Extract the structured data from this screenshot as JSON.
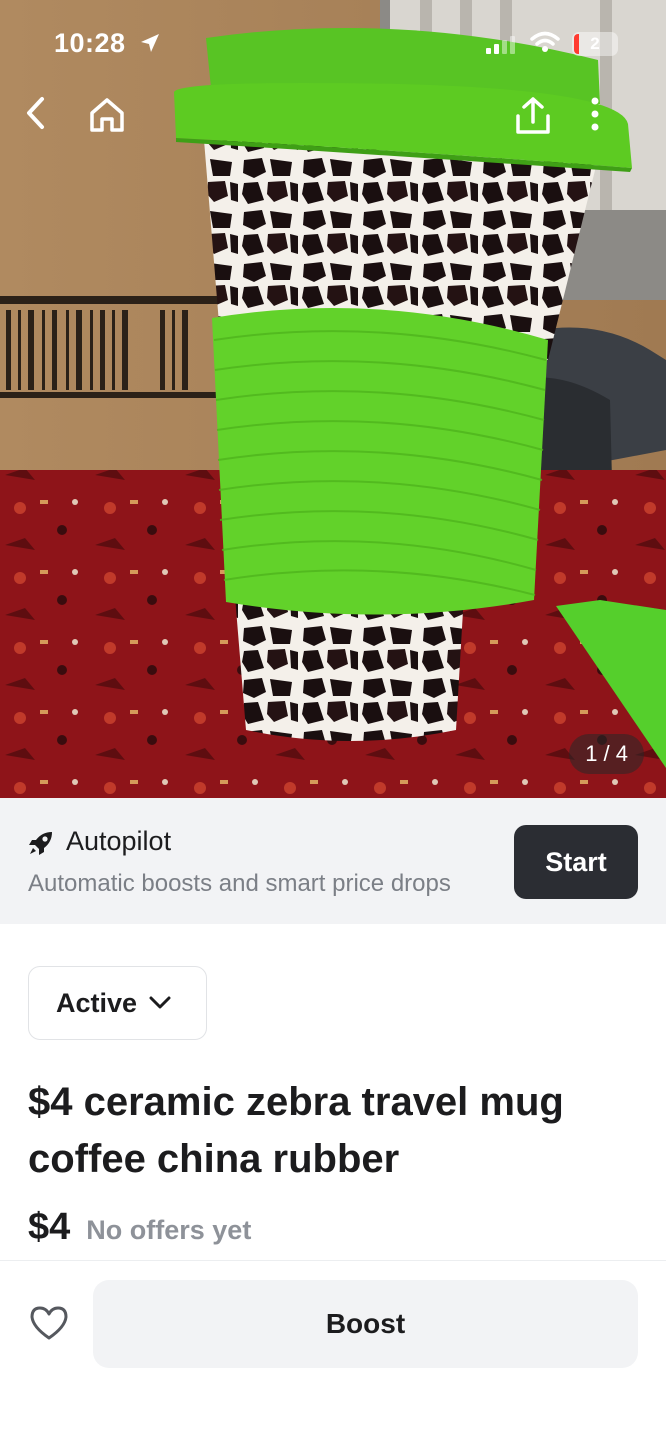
{
  "status_bar": {
    "time": "10:28",
    "battery_level": "2",
    "icons": [
      "location-arrow-icon",
      "cellular-signal-icon",
      "wifi-icon",
      "battery-icon"
    ]
  },
  "nav": {
    "icons": [
      "back-chevron-icon",
      "home-icon",
      "share-icon",
      "more-vertical-icon"
    ]
  },
  "photo": {
    "counter": "1 / 4",
    "mug_green": "#5bc51f",
    "rug_red": "#8b1017"
  },
  "autopilot": {
    "title": "Autopilot",
    "subtitle": "Automatic boosts and smart price drops",
    "button_label": "Start",
    "icon": "rocket-icon"
  },
  "listing": {
    "status": "Active",
    "title": "$4 ceramic zebra travel mug coffee china rubber",
    "price": "$4",
    "offers": "No offers yet"
  },
  "bottom_bar": {
    "boost_label": "Boost",
    "favorite_icon": "heart-outline-icon"
  },
  "colors": {
    "dark_button": "#2b2d33",
    "banner_bg": "#f2f3f5",
    "muted_text": "#7b7f86"
  }
}
